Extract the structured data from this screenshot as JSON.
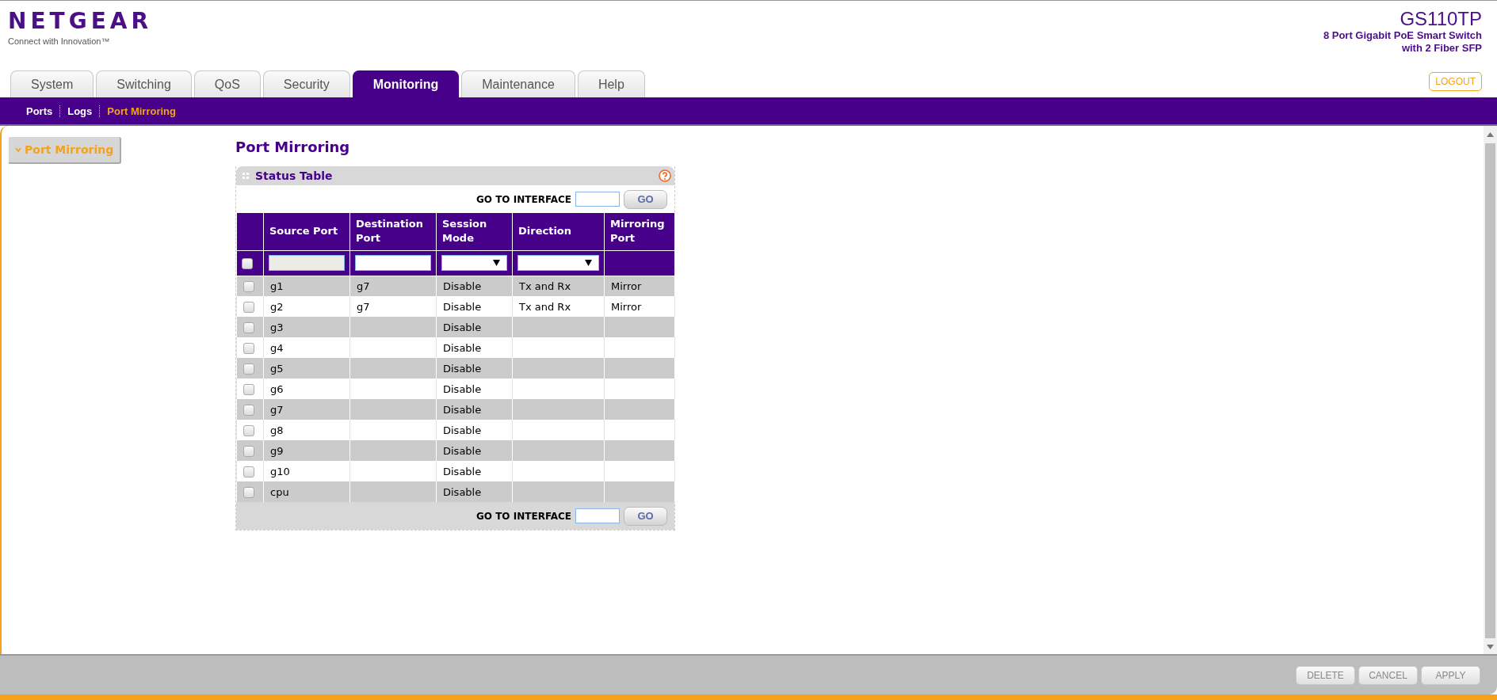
{
  "header": {
    "logo": "NETGEAR",
    "tagline": "Connect with Innovation™",
    "model": "GS110TP",
    "description": [
      "8 Port Gigabit PoE Smart Switch",
      "with 2 Fiber SFP"
    ],
    "logout": "LOGOUT"
  },
  "tabs": [
    {
      "label": "System",
      "selected": false
    },
    {
      "label": "Switching",
      "selected": false
    },
    {
      "label": "QoS",
      "selected": false
    },
    {
      "label": "Security",
      "selected": false
    },
    {
      "label": "Monitoring",
      "selected": true
    },
    {
      "label": "Maintenance",
      "selected": false
    },
    {
      "label": "Help",
      "selected": false
    }
  ],
  "subnav": [
    {
      "label": "Ports",
      "selected": false
    },
    {
      "label": "Logs",
      "selected": false
    },
    {
      "label": "Port Mirroring",
      "selected": true
    }
  ],
  "sidebar": {
    "items": [
      {
        "label": "Port Mirroring",
        "selected": true
      }
    ]
  },
  "page_title": "Port Mirroring",
  "panel": {
    "title": "Status Table",
    "goto_top": {
      "label": "GO TO INTERFACE",
      "button": "GO"
    },
    "columns": [
      "Source Port",
      "Destination Port",
      "Session Mode",
      "Direction",
      "Mirroring Port"
    ],
    "filter": {
      "checked": false,
      "fields": [
        {
          "kind": "text",
          "disabled": true
        },
        {
          "kind": "text",
          "disabled": false
        },
        {
          "kind": "select"
        },
        {
          "kind": "select"
        },
        {
          "kind": "none"
        }
      ]
    },
    "rows": [
      {
        "checked": false,
        "cells": [
          "g1",
          "g7",
          "Disable",
          "Tx and Rx",
          "Mirror"
        ]
      },
      {
        "checked": false,
        "cells": [
          "g2",
          "g7",
          "Disable",
          "Tx and Rx",
          "Mirror"
        ]
      },
      {
        "checked": false,
        "cells": [
          "g3",
          "",
          "Disable",
          "",
          ""
        ]
      },
      {
        "checked": false,
        "cells": [
          "g4",
          "",
          "Disable",
          "",
          ""
        ]
      },
      {
        "checked": false,
        "cells": [
          "g5",
          "",
          "Disable",
          "",
          ""
        ]
      },
      {
        "checked": false,
        "cells": [
          "g6",
          "",
          "Disable",
          "",
          ""
        ]
      },
      {
        "checked": false,
        "cells": [
          "g7",
          "",
          "Disable",
          "",
          ""
        ]
      },
      {
        "checked": false,
        "cells": [
          "g8",
          "",
          "Disable",
          "",
          ""
        ]
      },
      {
        "checked": false,
        "cells": [
          "g9",
          "",
          "Disable",
          "",
          ""
        ]
      },
      {
        "checked": false,
        "cells": [
          "g10",
          "",
          "Disable",
          "",
          ""
        ]
      },
      {
        "checked": false,
        "cells": [
          "cpu",
          "",
          "Disable",
          "",
          ""
        ]
      }
    ],
    "goto_bottom": {
      "label": "GO TO INTERFACE",
      "button": "GO"
    }
  },
  "buttons": [
    {
      "label": "DELETE",
      "disabled": true
    },
    {
      "label": "CANCEL",
      "disabled": true
    },
    {
      "label": "APPLY",
      "disabled": true
    }
  ]
}
